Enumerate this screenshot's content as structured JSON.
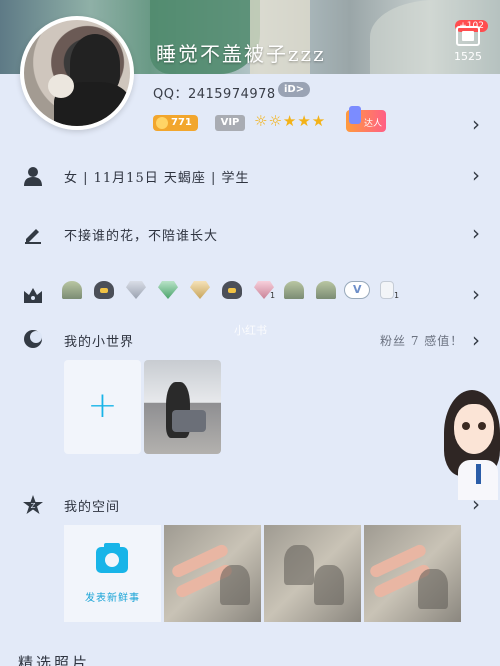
{
  "profile": {
    "nickname": "睡觉不盖被子zzz",
    "qq_line": "QQ：2415974978",
    "id_badge": "iD>",
    "coin_level": "771",
    "vip_label": "VIP",
    "level_glyphs": "☼☼★★★",
    "talent_label": "达人",
    "visitor_plus": "+102",
    "visitor_count": "1525"
  },
  "rows": {
    "info": {
      "icon": "person-icon",
      "text": "女 | 11月15日  天蝎座 | 学生"
    },
    "signature": {
      "icon": "pencil-icon",
      "text": "不接谁的花，不陪谁长大"
    },
    "gifts": {
      "icon": "crown-box-icon",
      "sub_badge_1": "1",
      "sub_badge_2": "1"
    },
    "world": {
      "icon": "moon-icon",
      "title": "我的小世界",
      "fans_text": "粉丝 7  感值！"
    },
    "space": {
      "icon": "z-star-icon",
      "title": "我的空间",
      "post_label": "发表新鲜事"
    }
  },
  "watermark": "小红书",
  "bottom_section_title": "精选照片",
  "icons": {
    "chevron": "chevron-right-icon",
    "add": "plus-icon",
    "camera": "camera-icon",
    "visitor": "visitor-icon"
  },
  "colors": {
    "accent": "#18b4e8",
    "vip_gold": "#f2a62d",
    "badge_red": "#ff4d4f",
    "panel": "#e3eaf8"
  }
}
